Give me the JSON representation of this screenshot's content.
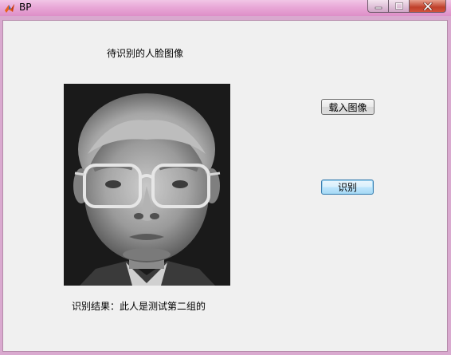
{
  "window": {
    "title": "BP",
    "controls": {
      "minimize_icon": "minimize-icon",
      "maximize_icon": "maximize-icon",
      "close_icon": "close-icon"
    },
    "app_icon": "matlab-icon"
  },
  "colors": {
    "title_bar": "#e9a8d7",
    "client_background": "#f0f0f0",
    "close_button": "#c0402b",
    "focused_button_border": "#3c7fb1"
  },
  "main": {
    "image_caption": "待识别的人脸图像",
    "load_button_label": "载入图像",
    "recognize_button_label": "识别",
    "result_text": "识别结果：此人是测试第二组的"
  }
}
